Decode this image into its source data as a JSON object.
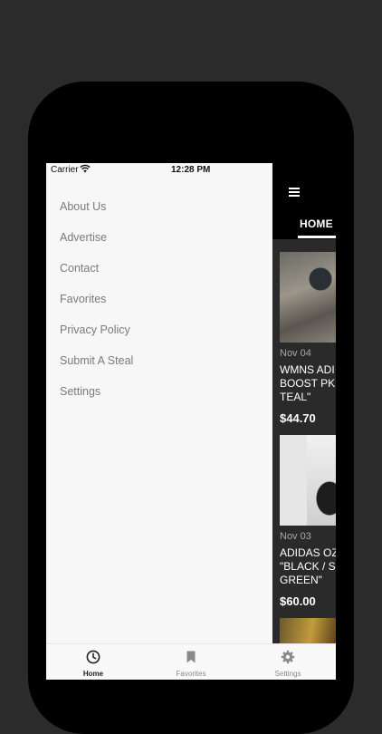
{
  "status_bar": {
    "carrier": "Carrier",
    "time": "12:28 PM"
  },
  "drawer": {
    "items": [
      {
        "label": "About Us"
      },
      {
        "label": "Advertise"
      },
      {
        "label": "Contact"
      },
      {
        "label": "Favorites"
      },
      {
        "label": "Privacy Policy"
      },
      {
        "label": "Submit A Steal"
      },
      {
        "label": "Settings"
      }
    ]
  },
  "header": {
    "tab_label": "HOME",
    "menu_icon": "hamburger-icon"
  },
  "feed": {
    "cards": [
      {
        "date": "Nov 04",
        "title_lines": [
          "WMNS ADI",
          "BOOST PK",
          "TEAL\""
        ],
        "price": "$44.70"
      },
      {
        "date": "Nov 03",
        "title_lines": [
          "ADIDAS OZ",
          "\"BLACK / S",
          "GREEN\""
        ],
        "price": "$60.00"
      }
    ]
  },
  "tabbar": {
    "tabs": [
      {
        "label": "Home",
        "icon": "clock-icon",
        "active": true
      },
      {
        "label": "Favorites",
        "icon": "bookmark-icon",
        "active": false
      },
      {
        "label": "Settings",
        "icon": "gear-icon",
        "active": false
      }
    ]
  },
  "colors": {
    "drawer_bg": "#f7f7f7",
    "menu_text": "#7a7a7a",
    "feed_bg": "#2a2a2a"
  }
}
